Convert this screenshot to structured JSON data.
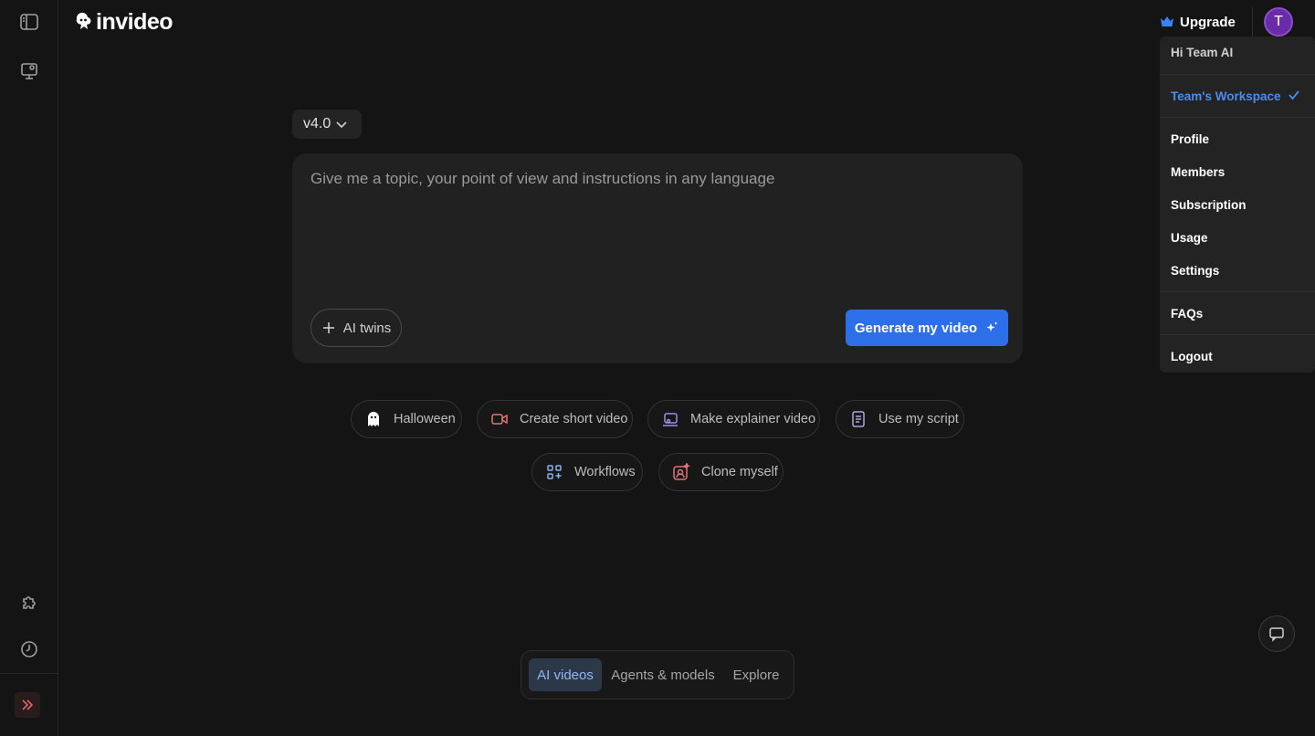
{
  "header": {
    "logo_text": "invideo",
    "upgrade_label": "Upgrade",
    "avatar_initial": "T"
  },
  "version": {
    "label": "v4.0"
  },
  "prompt": {
    "placeholder": "Give me a topic, your point of view and instructions in any language",
    "value": "",
    "ai_twins_label": "AI twins",
    "generate_label": "Generate my video"
  },
  "chips": [
    {
      "label": "Halloween",
      "icon": "ghost-icon"
    },
    {
      "label": "Create short video",
      "icon": "video-camera-icon"
    },
    {
      "label": "Make explainer video",
      "icon": "explainer-icon"
    },
    {
      "label": "Use my script",
      "icon": "script-document-icon"
    },
    {
      "label": "Workflows",
      "icon": "workflows-icon"
    },
    {
      "label": "Clone myself",
      "icon": "clone-myself-icon"
    }
  ],
  "tabs": [
    {
      "label": "AI videos",
      "active": true
    },
    {
      "label": "Agents & models",
      "active": false
    },
    {
      "label": "Explore",
      "active": false
    }
  ],
  "sidebar": {
    "icons": [
      "sidebar-toggle-icon",
      "presentation-icon",
      "puzzle-icon",
      "history-clock-icon",
      "expand-chevrons-icon"
    ]
  },
  "menu": {
    "greeting": "Hi Team AI",
    "workspace": "Team's Workspace",
    "items": [
      "Profile",
      "Members",
      "Subscription",
      "Usage",
      "Settings"
    ],
    "faqs": "FAQs",
    "logout": "Logout"
  },
  "colors": {
    "background": "#141414",
    "accent_blue": "#2d6fe8",
    "workspace_blue": "#4a8cf0",
    "avatar_purple": "#6a2ba8",
    "upgrade_crown": "#3b82f6"
  }
}
